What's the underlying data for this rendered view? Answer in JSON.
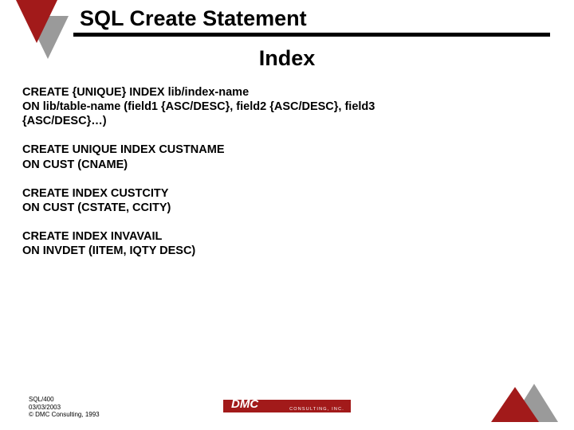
{
  "title": "SQL Create Statement",
  "subtitle": "Index",
  "blocks": [
    {
      "l1": "CREATE {UNIQUE} INDEX lib/index-name",
      "l2": "ON lib/table-name (field1 {ASC/DESC}, field2 {ASC/DESC}, field3",
      "l3": "{ASC/DESC}…)"
    },
    {
      "l1": "CREATE  UNIQUE INDEX CUSTNAME",
      "l2": "ON CUST (CNAME)"
    },
    {
      "l1": "CREATE INDEX CUSTCITY",
      "l2": "ON CUST (CSTATE, CCITY)"
    },
    {
      "l1": "CREATE INDEX INVAVAIL",
      "l2": "ON INVDET (IITEM, IQTY DESC)"
    }
  ],
  "footer": {
    "line1": "SQL/400",
    "line2": "03/03/2003",
    "line3": "DMC Consulting, 1993",
    "logo_text": "DMC",
    "logo_sub": "CONSULTING, INC."
  },
  "colors": {
    "brand_red": "#a21a1a",
    "brand_gray": "#9a9a9a"
  }
}
